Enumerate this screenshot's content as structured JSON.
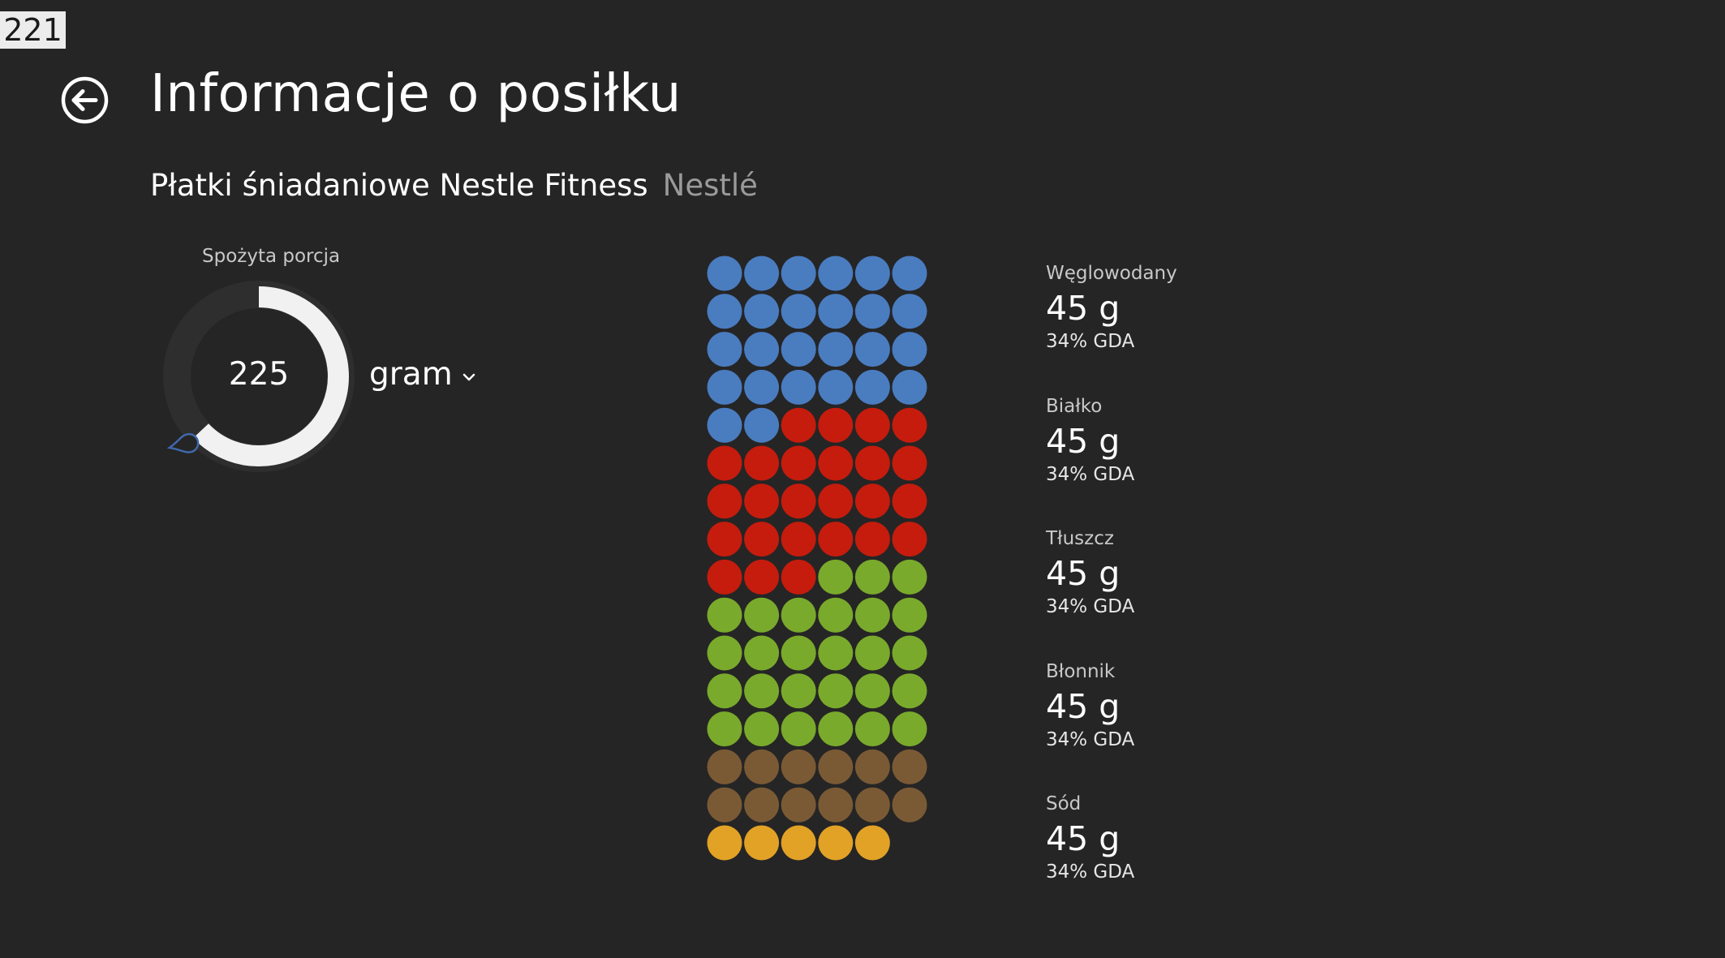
{
  "badge": {
    "value": "221"
  },
  "header": {
    "title": "Informacje o posiłku",
    "back_icon": "back-arrow-circle-icon"
  },
  "product": {
    "name": "Płatki śniadaniowe Nestle Fitness",
    "brand": "Nestlé"
  },
  "portion": {
    "label": "Spożyta porcja",
    "value": "225",
    "unit": "gram",
    "dial_fraction": 0.63
  },
  "colors": {
    "background": "#252525",
    "carbohydrate": "#4a7cc0",
    "protein": "#c51c0d",
    "fat": "#7aaa2c",
    "fiber": "#7a5a35",
    "sodium": "#e2a226",
    "dial_track": "#2e2e2e",
    "dial_ring": "#f1f1f1",
    "dial_handle": "#3f68ad"
  },
  "dot_chart": {
    "columns": 6,
    "segments": [
      {
        "nutrient": "carbohydrate",
        "count": 26
      },
      {
        "nutrient": "protein",
        "count": 25
      },
      {
        "nutrient": "fat",
        "count": 27
      },
      {
        "nutrient": "fiber",
        "count": 12
      },
      {
        "nutrient": "sodium",
        "count": 5
      }
    ]
  },
  "nutrients": [
    {
      "name": "Węglowodany",
      "amount": "45 g",
      "gda": "34% GDA"
    },
    {
      "name": "Białko",
      "amount": "45 g",
      "gda": "34% GDA"
    },
    {
      "name": "Tłuszcz",
      "amount": "45 g",
      "gda": "34% GDA"
    },
    {
      "name": "Błonnik",
      "amount": "45 g",
      "gda": "34% GDA"
    },
    {
      "name": "Sód",
      "amount": "45 g",
      "gda": "34% GDA"
    }
  ]
}
